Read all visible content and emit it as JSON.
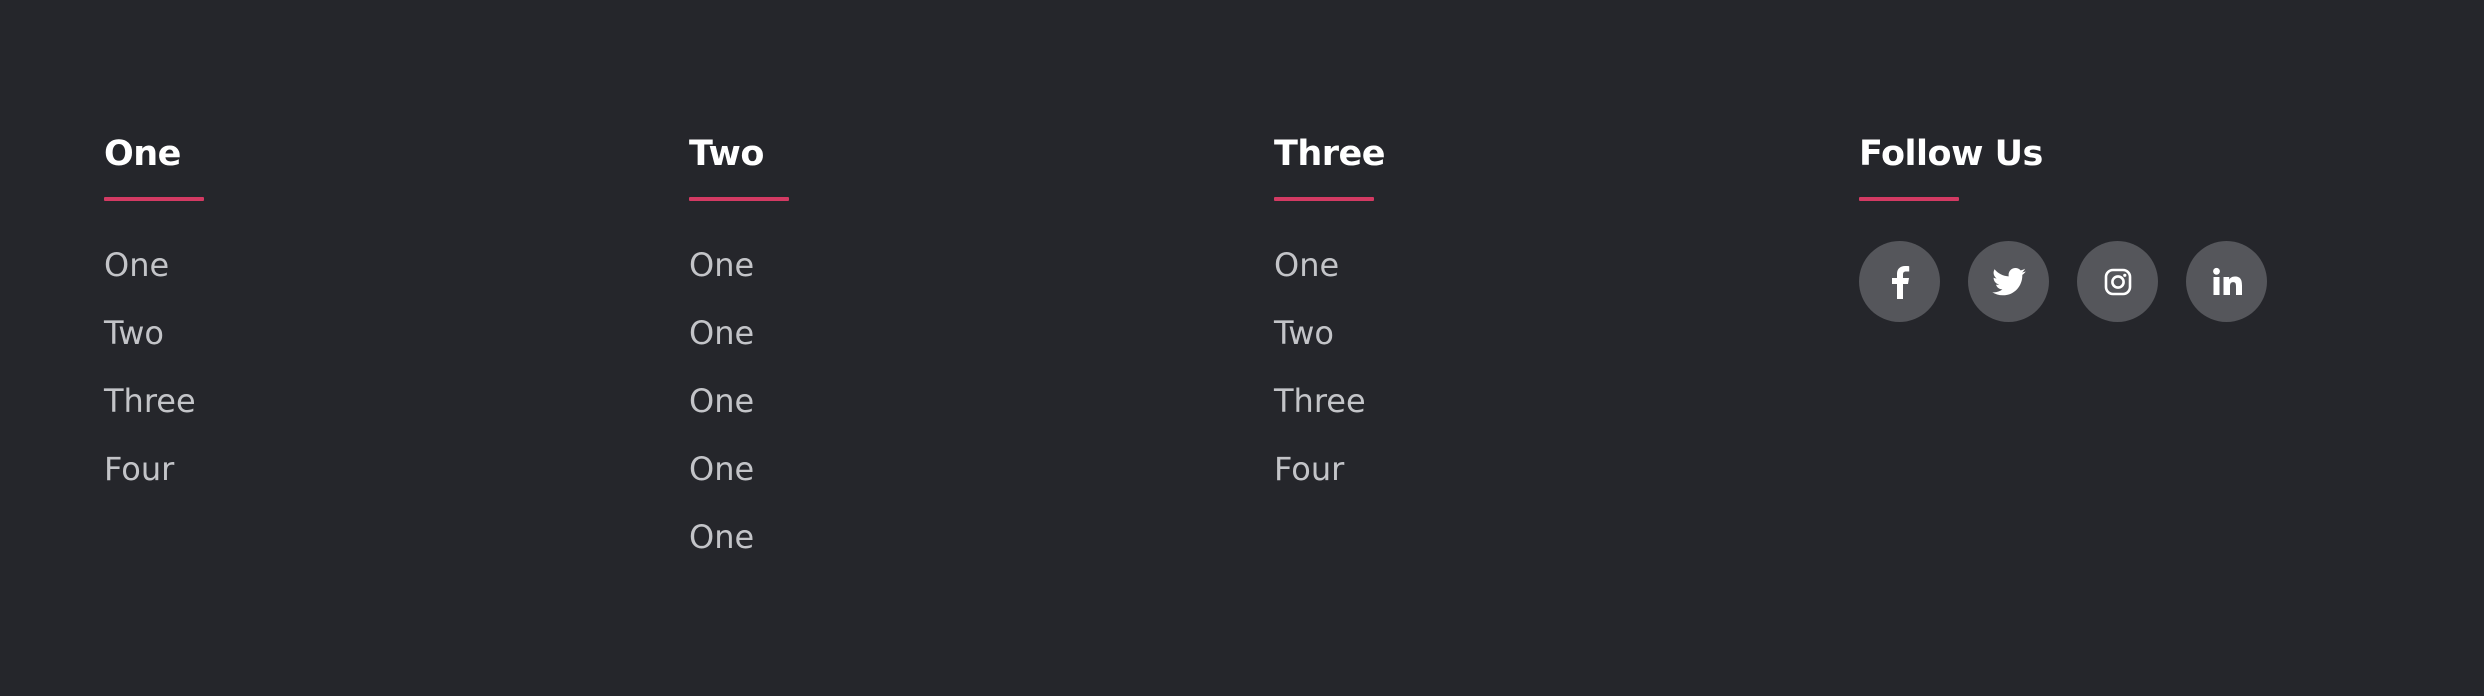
{
  "footer": {
    "columns": [
      {
        "heading": "One",
        "links": [
          "One",
          "Two",
          "Three",
          "Four"
        ]
      },
      {
        "heading": "Two",
        "links": [
          "One",
          "One",
          "One",
          "One",
          "One"
        ]
      },
      {
        "heading": "Three",
        "links": [
          "One",
          "Two",
          "Three",
          "Four"
        ]
      }
    ],
    "follow": {
      "heading": "Follow Us",
      "icons": [
        "facebook-icon",
        "twitter-icon",
        "instagram-icon",
        "linkedin-icon"
      ]
    }
  },
  "colors": {
    "background": "#25262b",
    "heading": "#ffffff",
    "link": "#c3c4c8",
    "accent": "#d33a63",
    "social_button": "#55565b"
  }
}
